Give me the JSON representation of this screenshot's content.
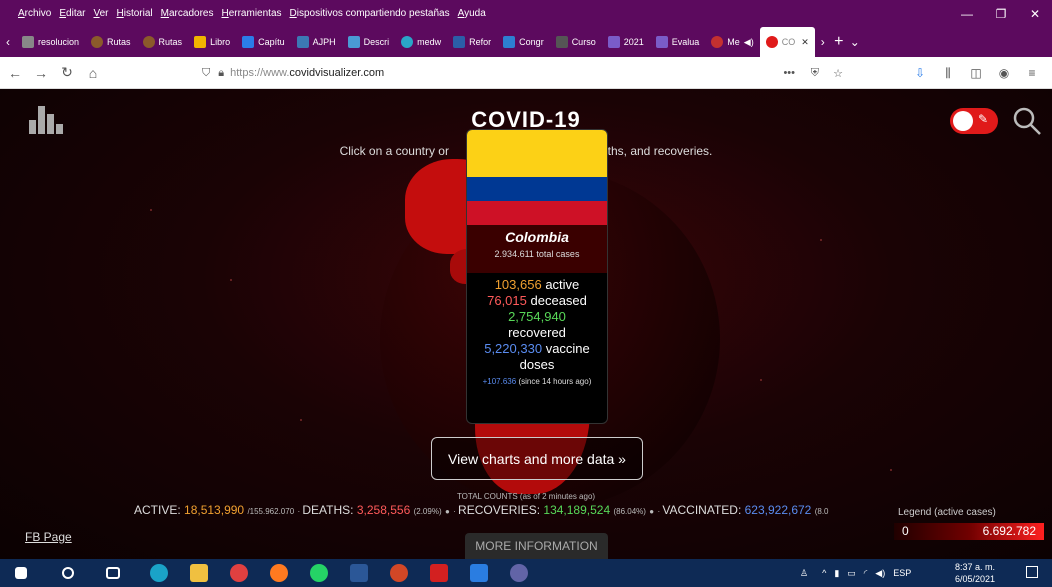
{
  "browser": {
    "menu": [
      "Archivo",
      "Editar",
      "Ver",
      "Historial",
      "Marcadores",
      "Herramientas",
      "Dispositivos compartiendo pestañas",
      "Ayuda"
    ],
    "tabs": [
      {
        "label": "resolucion",
        "color": "#5c0a5e"
      },
      {
        "label": "Rutas",
        "color": "#8b5a2b"
      },
      {
        "label": "Rutas",
        "color": "#8b5a2b"
      },
      {
        "label": "Libro",
        "color": "#f0b400"
      },
      {
        "label": "Capítu",
        "color": "#2b7de9"
      },
      {
        "label": "AJPH",
        "color": "#3c78b4"
      },
      {
        "label": "Descri",
        "color": "#4a9ad4"
      },
      {
        "label": "medw",
        "color": "#2aa6c8"
      },
      {
        "label": "Refor",
        "color": "#2b5ea8"
      },
      {
        "label": "Congr",
        "color": "#2d7fd1"
      },
      {
        "label": "Curso",
        "color": "#555555"
      },
      {
        "label": "2021",
        "color": "#7a5cc8"
      },
      {
        "label": "Evalua",
        "color": "#7a5cc8"
      },
      {
        "label": "Me",
        "color": "#c43030"
      }
    ],
    "active_tab": "CO",
    "url_protocol": "https://www.",
    "url_domain": "covidvisualizer.com"
  },
  "page": {
    "title": "COVID-19",
    "subtitle_left": "Click on a country or ",
    "subtitle_right": "eaths, and recoveries.",
    "view_button": "View charts and more data »",
    "fb_page": "FB Page",
    "more_info": "MORE INFORMATION"
  },
  "popup": {
    "country": "Colombia",
    "total": "2.934.611 total cases",
    "active_value": "103,656",
    "active_label": "active",
    "deceased_value": "76,015",
    "deceased_label": "deceased",
    "recovered_value": "2,754,940",
    "recovered_label": "recovered",
    "vaccine_value": "5,220,330",
    "vaccine_label": "vaccine",
    "vaccine_label2": "doses",
    "delta": "+107.636",
    "delta_note": "(since 14 hours ago)"
  },
  "totals": {
    "label": "TOTAL COUNTS (as of 2 minutes ago)",
    "active_label": "ACTIVE:",
    "active_value": "18,513,990",
    "active_of": "/155.962.070",
    "deaths_label": "DEATHS:",
    "deaths_value": "3,258,556",
    "deaths_pct": "(2.09%)",
    "recoveries_label": "RECOVERIES:",
    "recoveries_value": "134,189,524",
    "recoveries_pct": "(86.04%)",
    "vaccinated_label": "VACCINATED:",
    "vaccinated_value": "623,922,672",
    "vaccinated_pct": "(8.0"
  },
  "legend": {
    "title": "Legend (active cases)",
    "min": "0",
    "max": "6.692.782"
  },
  "taskbar": {
    "time": "8:37 a. m.",
    "date": "6/05/2021",
    "lang": "ESP"
  },
  "colors": {
    "active": "#f0a030",
    "deaths": "#ff5a5a",
    "recoveries": "#58d858",
    "vaccinated": "#5a8cf0",
    "accent": "#e01a1a"
  }
}
